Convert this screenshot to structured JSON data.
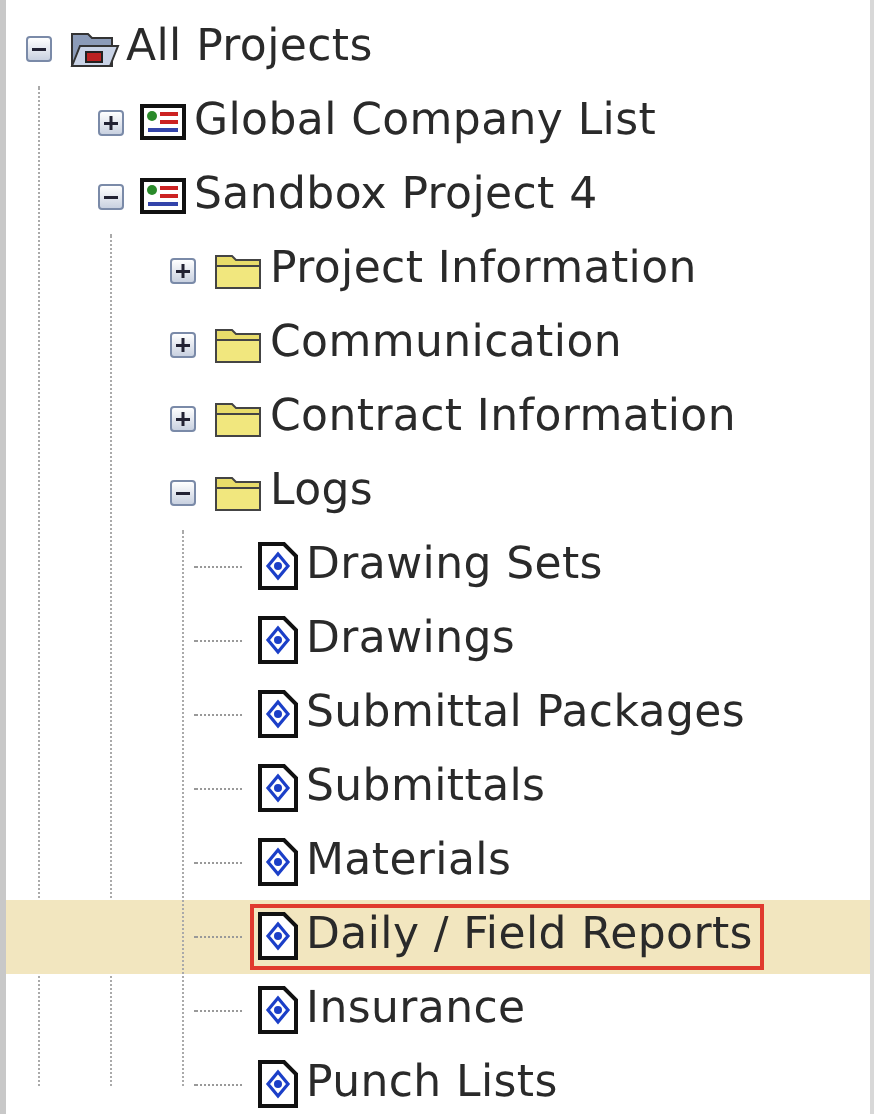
{
  "tree": [
    {
      "kind": "root",
      "label": "All Projects",
      "expanded": true,
      "selected": false,
      "children": [
        {
          "kind": "project",
          "label": "Global Company List",
          "expanded": false,
          "selected": false
        },
        {
          "kind": "project",
          "label": "Sandbox Project 4",
          "expanded": true,
          "selected": false,
          "children": [
            {
              "kind": "folder",
              "label": "Project Information",
              "expanded": false,
              "selected": false
            },
            {
              "kind": "folder",
              "label": "Communication",
              "expanded": false,
              "selected": false
            },
            {
              "kind": "folder",
              "label": "Contract Information",
              "expanded": false,
              "selected": false
            },
            {
              "kind": "folder",
              "label": "Logs",
              "expanded": true,
              "selected": false,
              "children": [
                {
                  "kind": "log",
                  "label": "Drawing Sets",
                  "selected": false
                },
                {
                  "kind": "log",
                  "label": "Drawings",
                  "selected": false
                },
                {
                  "kind": "log",
                  "label": "Submittal Packages",
                  "selected": false
                },
                {
                  "kind": "log",
                  "label": "Submittals",
                  "selected": false
                },
                {
                  "kind": "log",
                  "label": "Materials",
                  "selected": false
                },
                {
                  "kind": "log",
                  "label": "Daily / Field Reports",
                  "selected": true
                },
                {
                  "kind": "log",
                  "label": "Insurance",
                  "selected": false
                },
                {
                  "kind": "log",
                  "label": "Punch Lists",
                  "selected": false
                }
              ]
            }
          ]
        }
      ]
    }
  ]
}
